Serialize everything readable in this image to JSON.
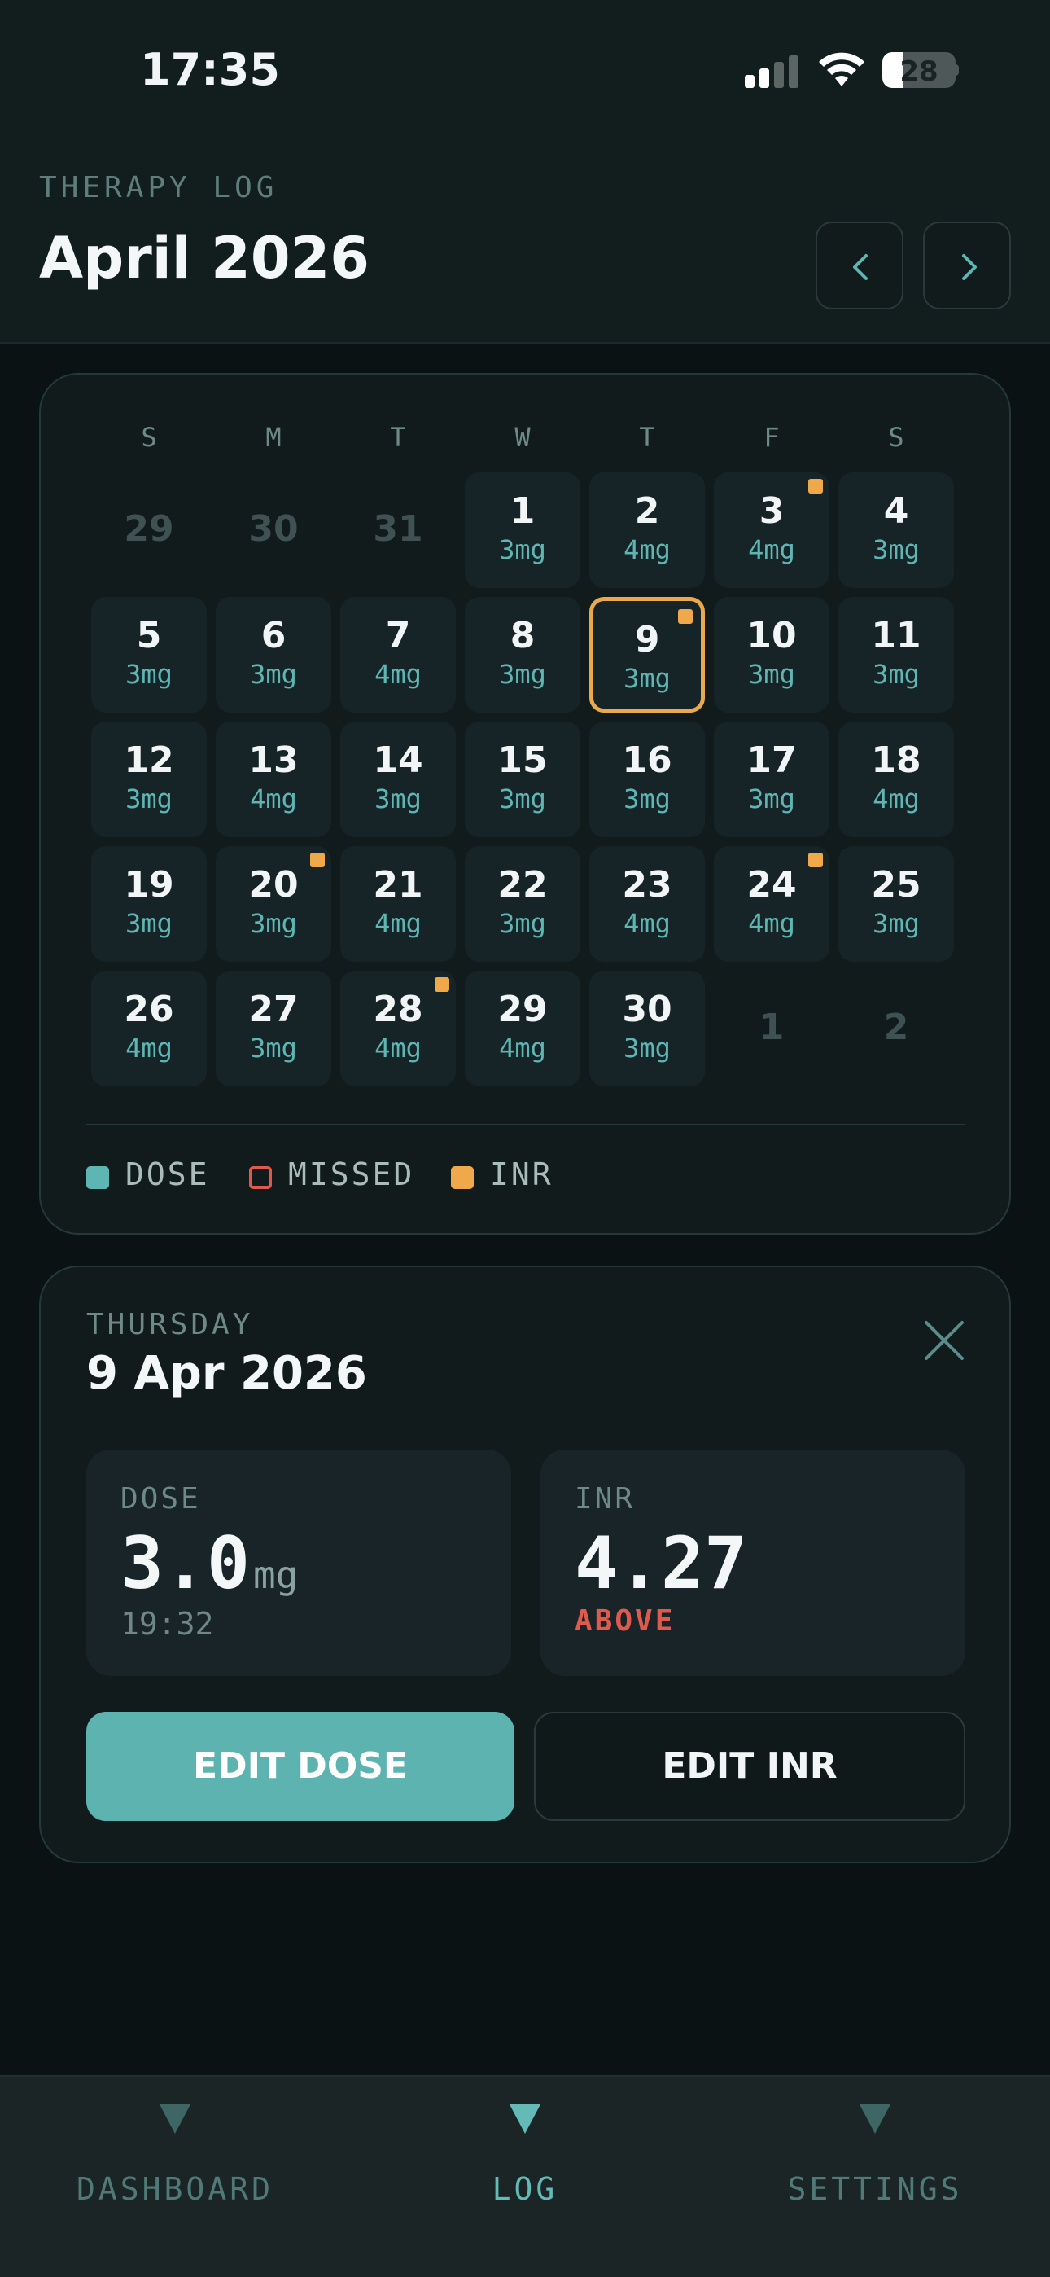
{
  "status": {
    "time": "17:35",
    "battery": "28"
  },
  "header": {
    "eyebrow": "THERAPY LOG",
    "month": "April 2026"
  },
  "calendar": {
    "weekdays": [
      "S",
      "M",
      "T",
      "W",
      "T",
      "F",
      "S"
    ],
    "weeks": [
      [
        {
          "day": "29",
          "out": true
        },
        {
          "day": "30",
          "out": true
        },
        {
          "day": "31",
          "out": true
        },
        {
          "day": "1",
          "dose": "3mg"
        },
        {
          "day": "2",
          "dose": "4mg"
        },
        {
          "day": "3",
          "dose": "4mg",
          "inr": true
        },
        {
          "day": "4",
          "dose": "3mg"
        }
      ],
      [
        {
          "day": "5",
          "dose": "3mg"
        },
        {
          "day": "6",
          "dose": "3mg"
        },
        {
          "day": "7",
          "dose": "4mg"
        },
        {
          "day": "8",
          "dose": "3mg"
        },
        {
          "day": "9",
          "dose": "3mg",
          "inr": true,
          "selected": true
        },
        {
          "day": "10",
          "dose": "3mg"
        },
        {
          "day": "11",
          "dose": "3mg"
        }
      ],
      [
        {
          "day": "12",
          "dose": "3mg"
        },
        {
          "day": "13",
          "dose": "4mg"
        },
        {
          "day": "14",
          "dose": "3mg"
        },
        {
          "day": "15",
          "dose": "3mg"
        },
        {
          "day": "16",
          "dose": "3mg"
        },
        {
          "day": "17",
          "dose": "3mg"
        },
        {
          "day": "18",
          "dose": "4mg"
        }
      ],
      [
        {
          "day": "19",
          "dose": "3mg"
        },
        {
          "day": "20",
          "dose": "3mg",
          "inr": true
        },
        {
          "day": "21",
          "dose": "4mg"
        },
        {
          "day": "22",
          "dose": "3mg"
        },
        {
          "day": "23",
          "dose": "4mg"
        },
        {
          "day": "24",
          "dose": "4mg",
          "inr": true
        },
        {
          "day": "25",
          "dose": "3mg"
        }
      ],
      [
        {
          "day": "26",
          "dose": "4mg"
        },
        {
          "day": "27",
          "dose": "3mg"
        },
        {
          "day": "28",
          "dose": "4mg",
          "inr": true
        },
        {
          "day": "29",
          "dose": "4mg"
        },
        {
          "day": "30",
          "dose": "3mg"
        },
        {
          "day": "1",
          "out": true
        },
        {
          "day": "2",
          "out": true
        }
      ]
    ],
    "legend": [
      {
        "label": "DOSE",
        "color": "#5db6b3",
        "style": "filled"
      },
      {
        "label": "MISSED",
        "color": "#e0594d",
        "style": "outline"
      },
      {
        "label": "INR",
        "color": "#f0a94a",
        "style": "filled"
      }
    ]
  },
  "detail": {
    "weekday": "THURSDAY",
    "date": "9 Apr 2026",
    "dose": {
      "label": "DOSE",
      "value": "3.0",
      "unit": "mg",
      "time": "19:32"
    },
    "inr": {
      "label": "INR",
      "value": "4.27",
      "status": "ABOVE"
    },
    "edit_dose_label": "EDIT DOSE",
    "edit_inr_label": "EDIT INR"
  },
  "tabs": [
    {
      "label": "DASHBOARD",
      "active": false
    },
    {
      "label": "LOG",
      "active": true
    },
    {
      "label": "SETTINGS",
      "active": false
    }
  ],
  "colors": {
    "accent": "#5db3b0",
    "inr": "#f0a94a",
    "missed": "#e0594d",
    "background": "#0a1214"
  }
}
